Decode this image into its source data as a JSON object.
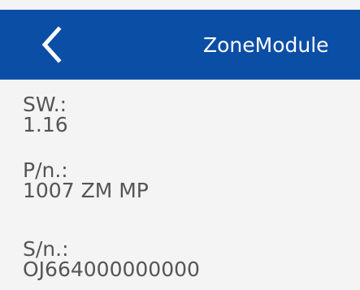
{
  "header": {
    "title": "ZoneModule",
    "back_icon": "chevron-left-icon",
    "background_color": "#0b4ea6"
  },
  "info": {
    "software": {
      "label": "SW.:",
      "value": "1.16"
    },
    "part_number": {
      "label": "P/n.:",
      "value": "1007 ZM MP"
    },
    "serial_number": {
      "label": "S/n.:",
      "value": "OJ664000000000"
    }
  }
}
